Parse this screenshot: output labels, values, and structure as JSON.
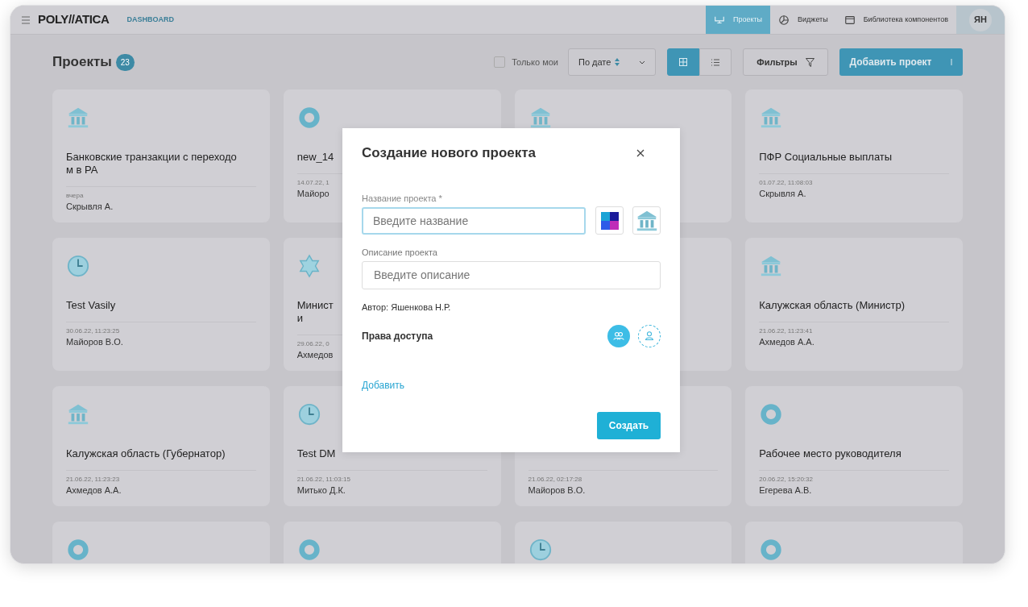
{
  "header": {
    "logo": "POLY//ATICA",
    "section": "DASHBOARD",
    "nav": [
      {
        "label": "Проекты",
        "kind": "monitor",
        "selected": true
      },
      {
        "label": "Виджеты",
        "kind": "pie",
        "selected": false
      },
      {
        "label": "Библиотека компонентов",
        "kind": "window",
        "selected": false
      }
    ],
    "avatar": "ЯН"
  },
  "toolbar": {
    "title": "Проекты",
    "count": "23",
    "only_mine": {
      "label": "Только мои",
      "checked": false
    },
    "sort": "По дате",
    "views": [
      {
        "kind": "grid",
        "selected": true
      },
      {
        "kind": "list",
        "selected": false
      }
    ],
    "filters": "Фильтры",
    "add": "Добавить проект"
  },
  "cards": [
    {
      "kind": "bank",
      "title": "Банковские транзакции с переходом в РА",
      "date": "вчера",
      "author": "Скрывля А."
    },
    {
      "kind": "donut",
      "title": "new_14",
      "date": "14.07.22, 1",
      "author": "Майоро"
    },
    {
      "kind": "bank"
    },
    {
      "kind": "bank",
      "title": "ПФР Социальные выплаты",
      "date": "01.07.22, 11:08:03",
      "author": "Скрывля А."
    },
    {
      "kind": "clock",
      "title": "Test Vasily",
      "date": "30.06.22, 11:23:25",
      "author": "Майоров В.О."
    },
    {
      "kind": "star",
      "title": "Минист\nи",
      "date": "29.06.22, 0",
      "author": "Ахмедов"
    },
    {
      "kind": "blank"
    },
    {
      "kind": "bank",
      "title": "Калужская область (Министр)",
      "date": "21.06.22, 11:23:41",
      "author": "Ахмедов А.А."
    },
    {
      "kind": "bank",
      "title": "Калужская область (Губернатор)",
      "date": "21.06.22, 11:23:23",
      "author": "Ахмедов А.А."
    },
    {
      "kind": "clock",
      "title": "Test DM",
      "date": "21.06.22, 11:03:15",
      "author": "Митько Д.К."
    },
    {
      "kind": "blank",
      "date": "21.06.22, 02:17:28",
      "author": "Майоров В.О."
    },
    {
      "kind": "donut",
      "title": "Рабочее место руководителя",
      "date": "20.06.22, 15:20:32",
      "author": "Егерева А.В."
    },
    {
      "kind": "donut"
    },
    {
      "kind": "donut"
    },
    {
      "kind": "clock"
    },
    {
      "kind": "donut"
    }
  ],
  "dialog": {
    "title": "Создание нового проекта",
    "name_label": "Название проекта *",
    "name_placeholder": "Введите название",
    "description_label": "Описание проекта",
    "description_placeholder": "Введите описание",
    "author": "Автор: Яшенкова Н.Р.",
    "access_label": "Права доступа",
    "access_modes": [
      {
        "kind": "group",
        "selected": true
      },
      {
        "kind": "user",
        "selected": false
      }
    ],
    "add_link": "Добавить",
    "create": "Создать"
  }
}
